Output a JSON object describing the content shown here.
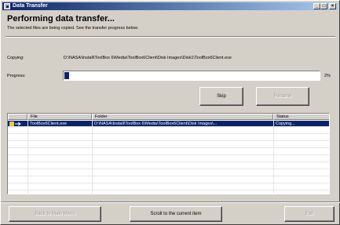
{
  "window": {
    "title": "Data Transfer",
    "controls": {
      "minimize": "_",
      "maximize": "□",
      "close": "×"
    }
  },
  "heading": "Performing data transfer...",
  "subtext": "The selected files are being copied. See the transfer progress below.",
  "copying": {
    "label": "Copying:",
    "path": "D:\\NASA\\Install\\ToolBox 6\\Media\\ToolBox6Client\\Disk Images\\Disk1\\ToolBox6Client.exe"
  },
  "progress": {
    "label": "Progress:",
    "percent_text": "2%",
    "fraction": 0.02
  },
  "buttons": {
    "skip": "Skip",
    "rename": "Rename",
    "back": "Back to Main Menu",
    "scroll": "Scroll to the current item",
    "exit": "Exit"
  },
  "list": {
    "columns": [
      "File",
      "Folder",
      "Status"
    ],
    "rows": [
      {
        "file": "ToolBox6Client.exe",
        "folder": "D:\\NASA\\Install\\ToolBox 6\\Media\\ToolBox6Client\\Disk Images\\...",
        "status": "Copying...",
        "selected": true,
        "icon": "arrow-right-icon"
      }
    ]
  },
  "colors": {
    "title_bar": "#0a246a",
    "selection": "#0a246a",
    "progress_fill": "#0a246a",
    "face": "#d4d0c8"
  }
}
